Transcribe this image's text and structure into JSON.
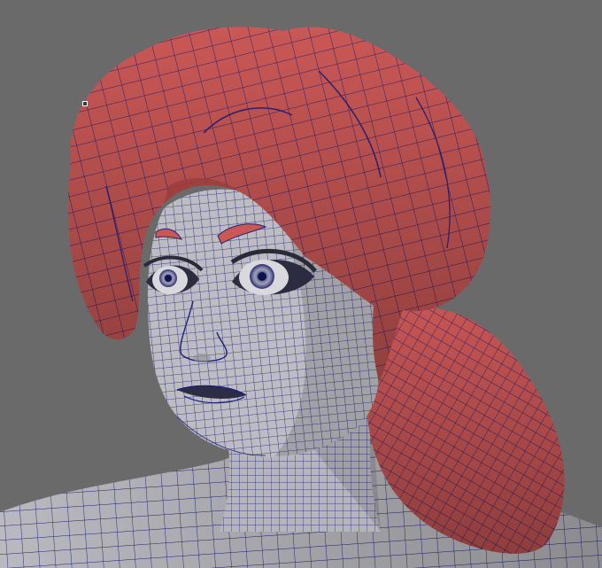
{
  "viewport": {
    "background": "#6a6a6a",
    "wireframe_color": "#1c1f7a",
    "skin_color": "#b9b9bf",
    "hair_color": "#c95856",
    "hair_shadow_color": "#9b3d3c",
    "skin_shadow_color": "#8f8f96"
  },
  "scene": {
    "objects": [
      {
        "name": "hair-mesh",
        "shading": "wireframe-on-shaded"
      },
      {
        "name": "head-mesh",
        "shading": "wireframe-on-shaded"
      },
      {
        "name": "eyebrow-left",
        "shading": "wireframe-on-shaded"
      },
      {
        "name": "eyebrow-right",
        "shading": "wireframe-on-shaded"
      },
      {
        "name": "eye-left"
      },
      {
        "name": "eye-right"
      },
      {
        "name": "ponytail-mesh",
        "shading": "wireframe-on-shaded"
      },
      {
        "name": "neck-shoulders-mesh",
        "shading": "wireframe-on-shaded"
      }
    ],
    "manipulator": "pivot-point-handle"
  }
}
